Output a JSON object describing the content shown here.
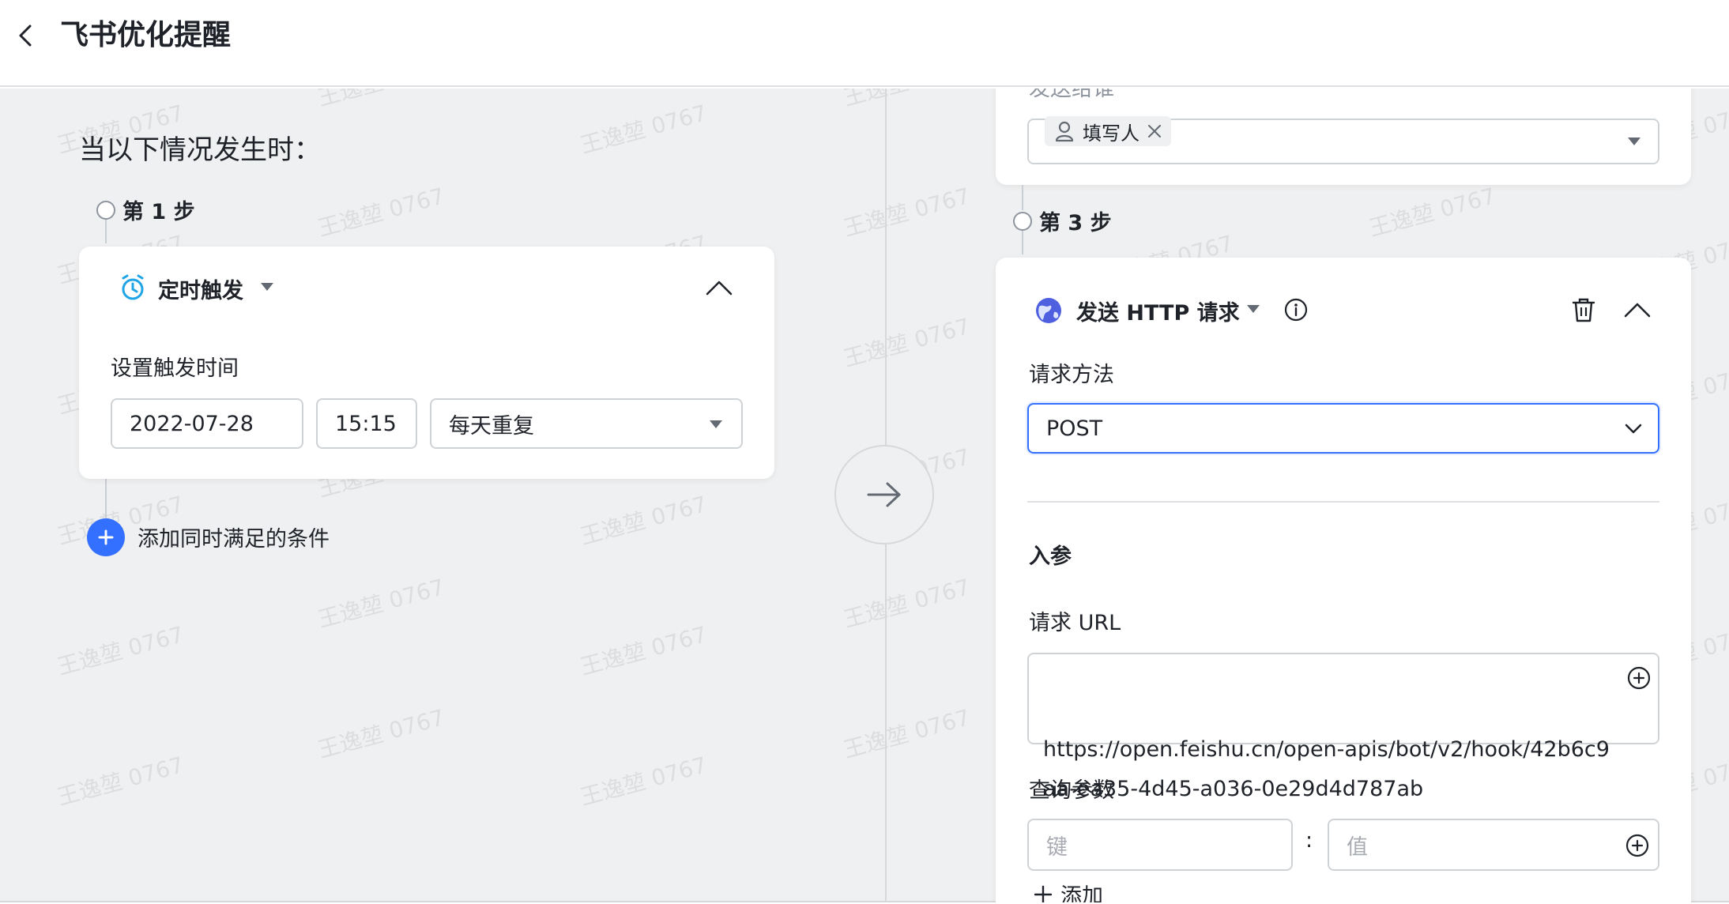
{
  "header": {
    "title": "飞书优化提醒"
  },
  "left": {
    "section_title": "当以下情况发生时：",
    "step1_label": "第 1 步",
    "trigger_card": {
      "trigger_name": "定时触发",
      "field_label": "设置触发时间",
      "date_value": "2022-07-28",
      "time_value": "15:15",
      "repeat_value": "每天重复"
    },
    "add_condition_label": "添加同时满足的条件"
  },
  "right": {
    "partial_label": "发送给谁",
    "recipient_tag": "填写人",
    "step3_label": "第 3 步",
    "http_card": {
      "title": "发送 HTTP 请求",
      "method_label": "请求方法",
      "method_value": "POST",
      "params_heading": "入参",
      "url_label": "请求 URL",
      "url_value": "https://open.feishu.cn/open-apis/bot/v2/hook/42b6c9aa-ea35-4d45-a036-0e29d4d787ab",
      "query_label": "查询参数",
      "key_placeholder": "键",
      "separator": ":",
      "value_placeholder": "值",
      "add_label": "添加"
    }
  },
  "watermark_text": "王逸堃 0767",
  "colors": {
    "accent": "#3370ff",
    "trigger_icon": "#1fa5e6",
    "http_icon": "#4e5fe0"
  },
  "icons": [
    "back-icon",
    "alarm-clock-icon",
    "chevron-up-icon",
    "arrow-right-icon",
    "plus-icon",
    "user-icon",
    "close-icon",
    "globe-icon",
    "info-icon",
    "trash-icon",
    "chevron-down-icon",
    "add-circle-icon"
  ]
}
